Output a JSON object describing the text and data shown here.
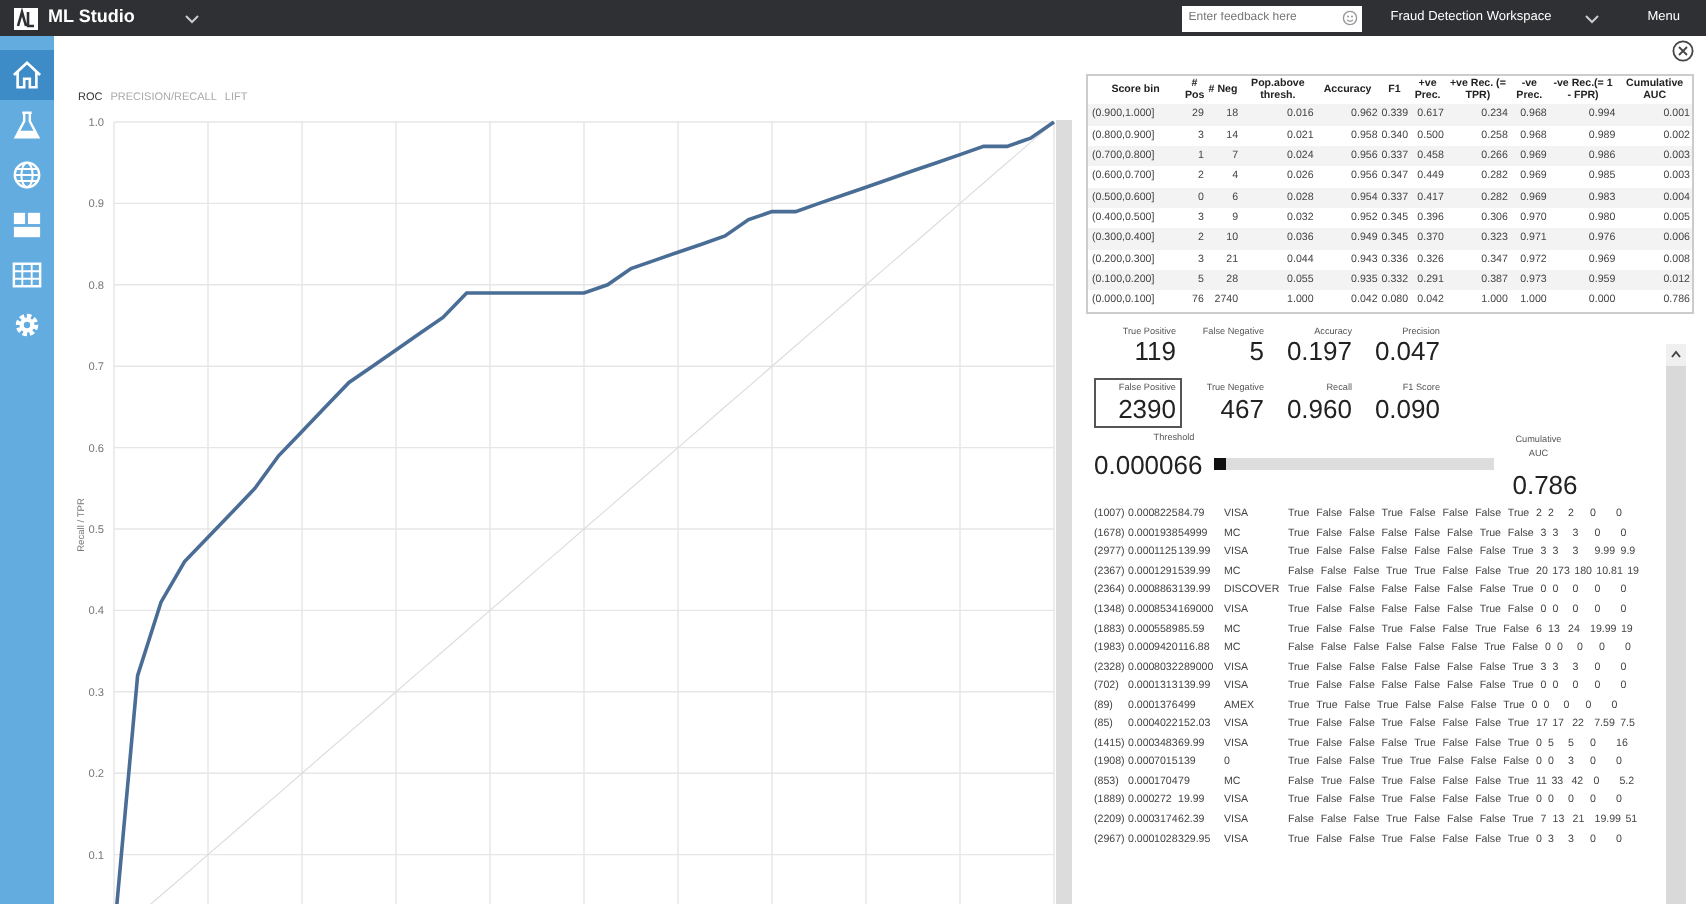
{
  "app": {
    "title": "ML Studio",
    "feedback_placeholder": "Enter feedback here",
    "workspace": "Fraud Detection Workspace",
    "menu": "Menu"
  },
  "sidebar": {
    "items": [
      {
        "selected": true
      },
      {
        "selected": false
      },
      {
        "selected": false
      },
      {
        "selected": false
      },
      {
        "selected": false
      },
      {
        "selected": false
      }
    ]
  },
  "chart_tabs": [
    {
      "label": "ROC",
      "selected": true
    },
    {
      "label": "PRECISION/RECALL",
      "selected": false
    },
    {
      "label": "LIFT",
      "selected": false
    }
  ],
  "chart": {
    "chart_data": {
      "type": "line",
      "ylabel": "Recall / TPR",
      "ylim": [
        0,
        1
      ],
      "grid": true,
      "yticks": [
        0.1,
        0.2,
        0.3,
        0.4,
        0.5,
        0.6,
        0.7,
        0.8,
        0.9,
        {
          "value": 1,
          "label": "1.0"
        }
      ],
      "categories": [
        null,
        null,
        null,
        null,
        null,
        null,
        null,
        null,
        null,
        null,
        null,
        null,
        null,
        null,
        null,
        null,
        null,
        null,
        null,
        null,
        null,
        null,
        null,
        null,
        null,
        null,
        null,
        null,
        null,
        null,
        null,
        null,
        null,
        null,
        null,
        null,
        null,
        null,
        null,
        null,
        null
      ],
      "series": [
        {
          "color": "#4a6d96",
          "values": [
            0,
            0.32,
            0.41,
            0.46,
            0.49,
            0.52,
            0.55,
            0.59,
            0.62,
            0.65,
            0.68,
            0.7,
            0.72,
            0.74,
            0.76,
            0.79,
            0.79,
            0.79,
            0.79,
            0.79,
            0.79,
            0.8,
            0.82,
            0.83,
            0.84,
            0.85,
            0.86,
            0.88,
            0.89,
            0.89,
            0.9,
            0.91,
            0.92,
            0.93,
            0.94,
            0.95,
            0.96,
            0.97,
            0.97,
            0.98,
            1.0
          ]
        },
        {
          "color": "#dddddd",
          "values": [
            0,
            0.025,
            0.05,
            0.075,
            0.1,
            0.125,
            0.15,
            0.175,
            0.2,
            0.225,
            0.25,
            0.275,
            0.3,
            0.325,
            0.35,
            0.375,
            0.4,
            0.425,
            0.45,
            0.475,
            0.5,
            0.525,
            0.55,
            0.575,
            0.6,
            0.625,
            0.65,
            0.675,
            0.7,
            0.725,
            0.75,
            0.775,
            0.8,
            0.825,
            0.85,
            0.875,
            0.9,
            0.925,
            0.95,
            0.975,
            1.0
          ]
        }
      ]
    }
  },
  "bin_table": {
    "columns": [
      "Score bin",
      "# Pos",
      "# Neg",
      "Pop.above thresh.",
      "Accuracy",
      "F1",
      "+ve Prec.",
      "+ve Rec. (= TPR)",
      "-ve Prec.",
      "-ve Rec.(= 1 - FPR)",
      "Cumulative AUC"
    ],
    "rows": [
      [
        "(0.900,1.000]",
        "29",
        "18",
        "0.016",
        "0.962",
        "0.339",
        "0.617",
        "0.234",
        "0.968",
        "0.994",
        "0.001"
      ],
      [
        "(0.800,0.900]",
        "3",
        "14",
        "0.021",
        "0.958",
        "0.340",
        "0.500",
        "0.258",
        "0.968",
        "0.989",
        "0.002"
      ],
      [
        "(0.700,0.800]",
        "1",
        "7",
        "0.024",
        "0.956",
        "0.337",
        "0.458",
        "0.266",
        "0.969",
        "0.986",
        "0.003"
      ],
      [
        "(0.600,0.700]",
        "2",
        "4",
        "0.026",
        "0.956",
        "0.347",
        "0.449",
        "0.282",
        "0.969",
        "0.985",
        "0.003"
      ],
      [
        "(0.500,0.600]",
        "0",
        "6",
        "0.028",
        "0.954",
        "0.337",
        "0.417",
        "0.282",
        "0.969",
        "0.983",
        "0.004"
      ],
      [
        "(0.400,0.500]",
        "3",
        "9",
        "0.032",
        "0.952",
        "0.345",
        "0.396",
        "0.306",
        "0.970",
        "0.980",
        "0.005"
      ],
      [
        "(0.300,0.400]",
        "2",
        "10",
        "0.036",
        "0.949",
        "0.345",
        "0.370",
        "0.323",
        "0.971",
        "0.976",
        "0.006"
      ],
      [
        "(0.200,0.300]",
        "3",
        "21",
        "0.044",
        "0.943",
        "0.336",
        "0.326",
        "0.347",
        "0.972",
        "0.969",
        "0.008"
      ],
      [
        "(0.100,0.200]",
        "5",
        "28",
        "0.055",
        "0.935",
        "0.332",
        "0.291",
        "0.387",
        "0.973",
        "0.959",
        "0.012"
      ],
      [
        "(0.000,0.100]",
        "76",
        "2740",
        "1.000",
        "0.042",
        "0.080",
        "0.042",
        "1.000",
        "1.000",
        "0.000",
        "0.786"
      ]
    ]
  },
  "metrics": [
    {
      "label": "True Positive",
      "value": "119",
      "selected": false
    },
    {
      "label": "False Negative",
      "value": "5",
      "selected": false
    },
    {
      "label": "Accuracy",
      "value": "0.197",
      "selected": false
    },
    {
      "label": "Precision",
      "value": "0.047",
      "selected": false
    },
    {
      "label": "False Positive",
      "value": "2390",
      "selected": true
    },
    {
      "label": "True Negative",
      "value": "467",
      "selected": false
    },
    {
      "label": "Recall",
      "value": "0.960",
      "selected": false
    },
    {
      "label": "F1 Score",
      "value": "0.090",
      "selected": false
    }
  ],
  "threshold": {
    "label": "Threshold",
    "value": "0.000066",
    "level": 0.0
  },
  "cumulative_auc": {
    "label": "Cumulative AUC",
    "value": "0.786"
  },
  "records": [
    [
      "(1007)",
      "0.000",
      "8225",
      "84.79",
      "VISA",
      "True",
      "False",
      "False",
      "True",
      "False",
      "False",
      "False",
      "True",
      "2",
      "2",
      "2",
      "0",
      "0"
    ],
    [
      "(1678)",
      "0.000",
      "1938",
      "54999",
      "MC",
      "True",
      "False",
      "False",
      "False",
      "False",
      "False",
      "True",
      "False",
      "3",
      "3",
      "3",
      "0",
      "0"
    ],
    [
      "(2977)",
      "0.000",
      "1125",
      "139.99",
      "VISA",
      "True",
      "False",
      "False",
      "False",
      "False",
      "False",
      "False",
      "True",
      "3",
      "3",
      "3",
      "9.99",
      "9.9"
    ],
    [
      "(2367)",
      "0.000",
      "1291",
      "539.99",
      "MC",
      "False",
      "False",
      "False",
      "True",
      "True",
      "False",
      "False",
      "True",
      "20",
      "173",
      "180",
      "10.81",
      "19"
    ],
    [
      "(2364)",
      "0.000",
      "8863",
      "139.99",
      "DISCOVER",
      "True",
      "False",
      "False",
      "False",
      "False",
      "False",
      "False",
      "True",
      "0",
      "0",
      "0",
      "0",
      "0"
    ],
    [
      "(1348)",
      "0.000",
      "8534",
      "169000",
      "VISA",
      "True",
      "False",
      "False",
      "False",
      "False",
      "False",
      "True",
      "False",
      "0",
      "0",
      "0",
      "0",
      "0"
    ],
    [
      "(1883)",
      "0.000",
      "5589",
      "85.59",
      "MC",
      "True",
      "False",
      "False",
      "True",
      "False",
      "False",
      "True",
      "False",
      "6",
      "13",
      "24",
      "19.99",
      "19"
    ],
    [
      "(1983)",
      "0.000",
      "9420",
      "116.88",
      "MC",
      "False",
      "False",
      "False",
      "False",
      "False",
      "False",
      "True",
      "False",
      "0",
      "0",
      "0",
      "0",
      "0"
    ],
    [
      "(2328)",
      "0.000",
      "8032",
      "289000",
      "VISA",
      "True",
      "False",
      "False",
      "False",
      "False",
      "False",
      "False",
      "True",
      "3",
      "3",
      "3",
      "0",
      "0"
    ],
    [
      "(702)",
      "0.000",
      "1313",
      "139.99",
      "VISA",
      "True",
      "False",
      "False",
      "False",
      "False",
      "False",
      "False",
      "True",
      "0",
      "0",
      "0",
      "0",
      "0"
    ],
    [
      "(89)",
      "0.000",
      "1376",
      "499",
      "AMEX",
      "True",
      "True",
      "False",
      "True",
      "False",
      "False",
      "False",
      "True",
      "0",
      "0",
      "0",
      "0",
      "0"
    ],
    [
      "(85)",
      "0.000",
      "4022",
      "152.03",
      "VISA",
      "True",
      "False",
      "False",
      "True",
      "False",
      "False",
      "False",
      "True",
      "17",
      "17",
      "22",
      "7.59",
      "7.5"
    ],
    [
      "(1415)",
      "0.000",
      "3483",
      "69.99",
      "VISA",
      "True",
      "False",
      "False",
      "False",
      "True",
      "False",
      "False",
      "True",
      "0",
      "5",
      "5",
      "0",
      "16"
    ],
    [
      "(1908)",
      "0.000",
      "7015",
      "139",
      "0",
      "True",
      "False",
      "False",
      "True",
      "True",
      "False",
      "False",
      "False",
      "0",
      "0",
      "3",
      "0",
      "0"
    ],
    [
      "(853)",
      "0.000",
      "1704",
      "79",
      "MC",
      "False",
      "True",
      "False",
      "True",
      "False",
      "False",
      "False",
      "True",
      "11",
      "33",
      "42",
      "0",
      "5.2"
    ],
    [
      "(1889)",
      "0.000",
      "272",
      "19.99",
      "VISA",
      "True",
      "False",
      "False",
      "True",
      "False",
      "False",
      "False",
      "True",
      "0",
      "0",
      "0",
      "0",
      "0"
    ],
    [
      "(2209)",
      "0.000",
      "3174",
      "62.39",
      "VISA",
      "False",
      "False",
      "False",
      "True",
      "False",
      "False",
      "False",
      "True",
      "7",
      "13",
      "21",
      "19.99",
      "51"
    ],
    [
      "(2967)",
      "0.000",
      "1028",
      "329.95",
      "VISA",
      "True",
      "False",
      "False",
      "True",
      "False",
      "False",
      "False",
      "True",
      "0",
      "3",
      "3",
      "0",
      "0"
    ]
  ]
}
